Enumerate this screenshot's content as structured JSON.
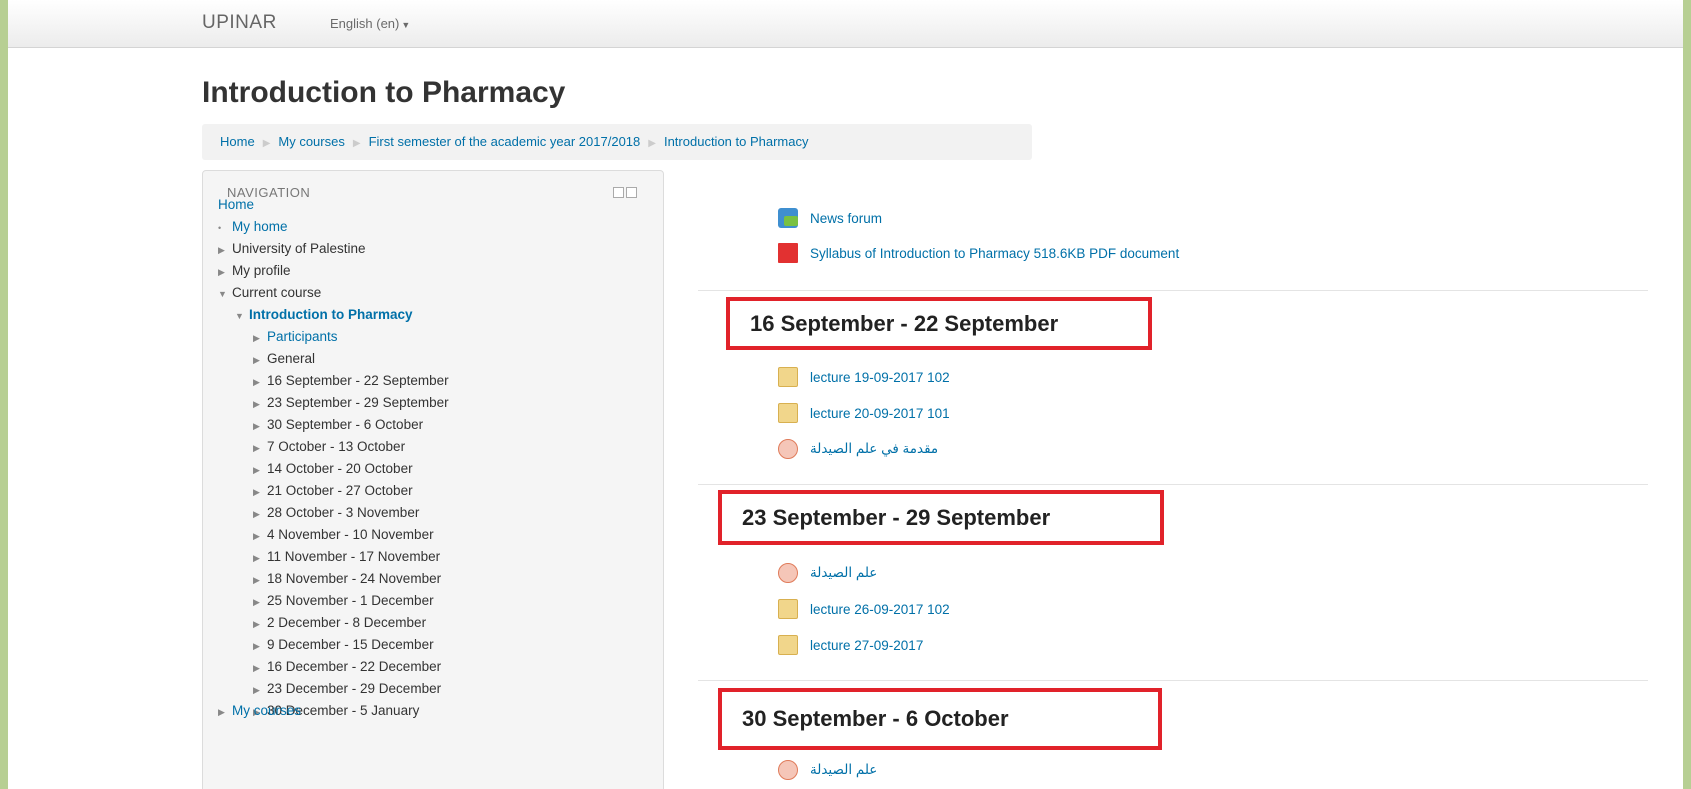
{
  "navbar": {
    "brand": "UPINAR",
    "language": "English (en)"
  },
  "page_title": "Introduction to Pharmacy",
  "breadcrumb": [
    "Home",
    "My courses",
    "First semester of the academic year 2017/2018",
    "Introduction to Pharmacy"
  ],
  "navigation": {
    "header": "NAVIGATION",
    "home": "Home",
    "my_home": "My home",
    "university": "University of Palestine",
    "my_profile": "My profile",
    "current_course": "Current course",
    "course": "Introduction to Pharmacy",
    "participants": "Participants",
    "general": "General",
    "weeks": [
      "16 September - 22 September",
      "23 September - 29 September",
      "30 September - 6 October",
      "7 October - 13 October",
      "14 October - 20 October",
      "21 October - 27 October",
      "28 October - 3 November",
      "4 November - 10 November",
      "11 November - 17 November",
      "18 November - 24 November",
      "25 November - 1 December",
      "2 December - 8 December",
      "9 December - 15 December",
      "16 December - 22 December",
      "23 December - 29 December",
      "30 December - 5 January"
    ],
    "my_courses": "My courses"
  },
  "content": {
    "general": {
      "news_forum": "News forum",
      "syllabus": "Syllabus of Introduction to Pharmacy 518.6KB PDF document"
    },
    "sections": [
      {
        "title": "16 September - 22 September",
        "items": [
          "lecture 19-09-2017 102",
          "lecture 20-09-2017 101",
          "مقدمة في علم الصيدلة"
        ]
      },
      {
        "title": "23 September - 29 September",
        "items": [
          "علم الصيدلة",
          "lecture 26-09-2017 102",
          "lecture 27-09-2017"
        ]
      },
      {
        "title": "30 September - 6 October",
        "items": [
          "علم الصيدلة"
        ]
      }
    ]
  }
}
